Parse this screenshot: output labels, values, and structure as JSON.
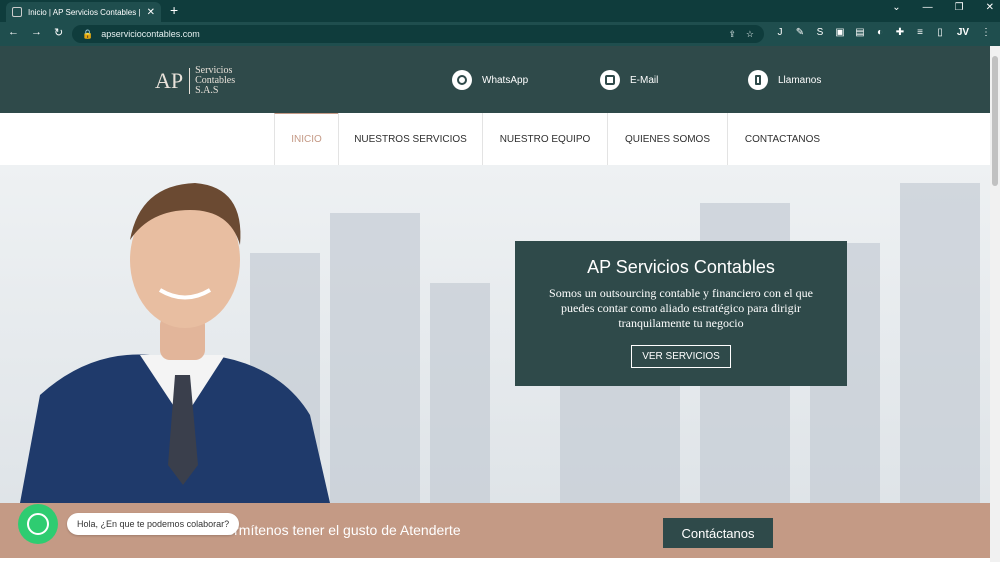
{
  "browser": {
    "tab_title": "Inicio | AP Servicios Contables | S",
    "url": "apserviciocontables.com",
    "profile_initials": "JV"
  },
  "header": {
    "logo_ap": "AP",
    "logo_line1": "Servicios",
    "logo_line2": "Contables",
    "logo_line3": "S.A.S",
    "whatsapp_label": "WhatsApp",
    "email_label": "E-Mail",
    "call_label": "Llamanos"
  },
  "nav": {
    "items": [
      "INICIO",
      "NUESTROS SERVICIOS",
      "NUESTRO EQUIPO",
      "QUIENES SOMOS",
      "CONTACTANOS"
    ]
  },
  "hero": {
    "title": "AP Servicios Contables",
    "text": "Somos un outsourcing contable y financiero con el que puedes contar como aliado estratégico para dirigir tranquilamente tu negocio",
    "button": "VER SERVICIOS"
  },
  "band": {
    "text": "Permítenos tener el gusto de Atenderte",
    "button": "Contáctanos"
  },
  "whatsapp": {
    "bubble": "Hola, ¿En que te podemos colaborar?"
  }
}
